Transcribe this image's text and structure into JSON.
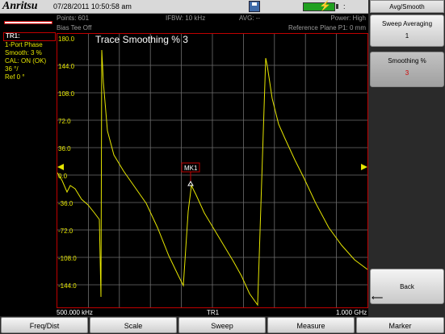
{
  "header": {
    "logo": "Anritsu",
    "datetime": "07/28/2011 10:50:58 am",
    "right_text": ":"
  },
  "status": {
    "points": "Points: 601",
    "bias_tee": "Bias Tee Off",
    "ifbw": "IFBW: 10 kHz",
    "avg": "AVG: --",
    "power": "Power: High",
    "ref_plane": "Reference Plane P1: 0 mm"
  },
  "trace_info": {
    "label": "TR1:",
    "lines": [
      "1-Port Phase",
      "Smooth: 3 %",
      "CAL: ON (OK)",
      "36 °/",
      "Ref 0 °"
    ]
  },
  "plot": {
    "title": "Trace Smoothing %   3",
    "y_ticks": [
      "180.0",
      "144.0",
      "108.0",
      "72.0",
      "36.0",
      "0.0",
      "-36.0",
      "-72.0",
      "-108.0",
      "-144.0"
    ],
    "x_start": "500.000 kHz",
    "x_center": "TR1",
    "x_stop": "1.000 GHz",
    "marker_label": "MK1",
    "trace_color": "#e6e600",
    "border_color": "#c00000"
  },
  "softkeys": {
    "menu_title": "Avg/Smooth",
    "sweep_averaging": {
      "label": "Sweep Averaging",
      "value": "1"
    },
    "smoothing": {
      "label": "Smoothing %",
      "value": "3"
    },
    "back": "Back"
  },
  "bottom_menu": [
    "Freq/Dist",
    "Scale",
    "Sweep",
    "Measure",
    "Marker"
  ]
}
